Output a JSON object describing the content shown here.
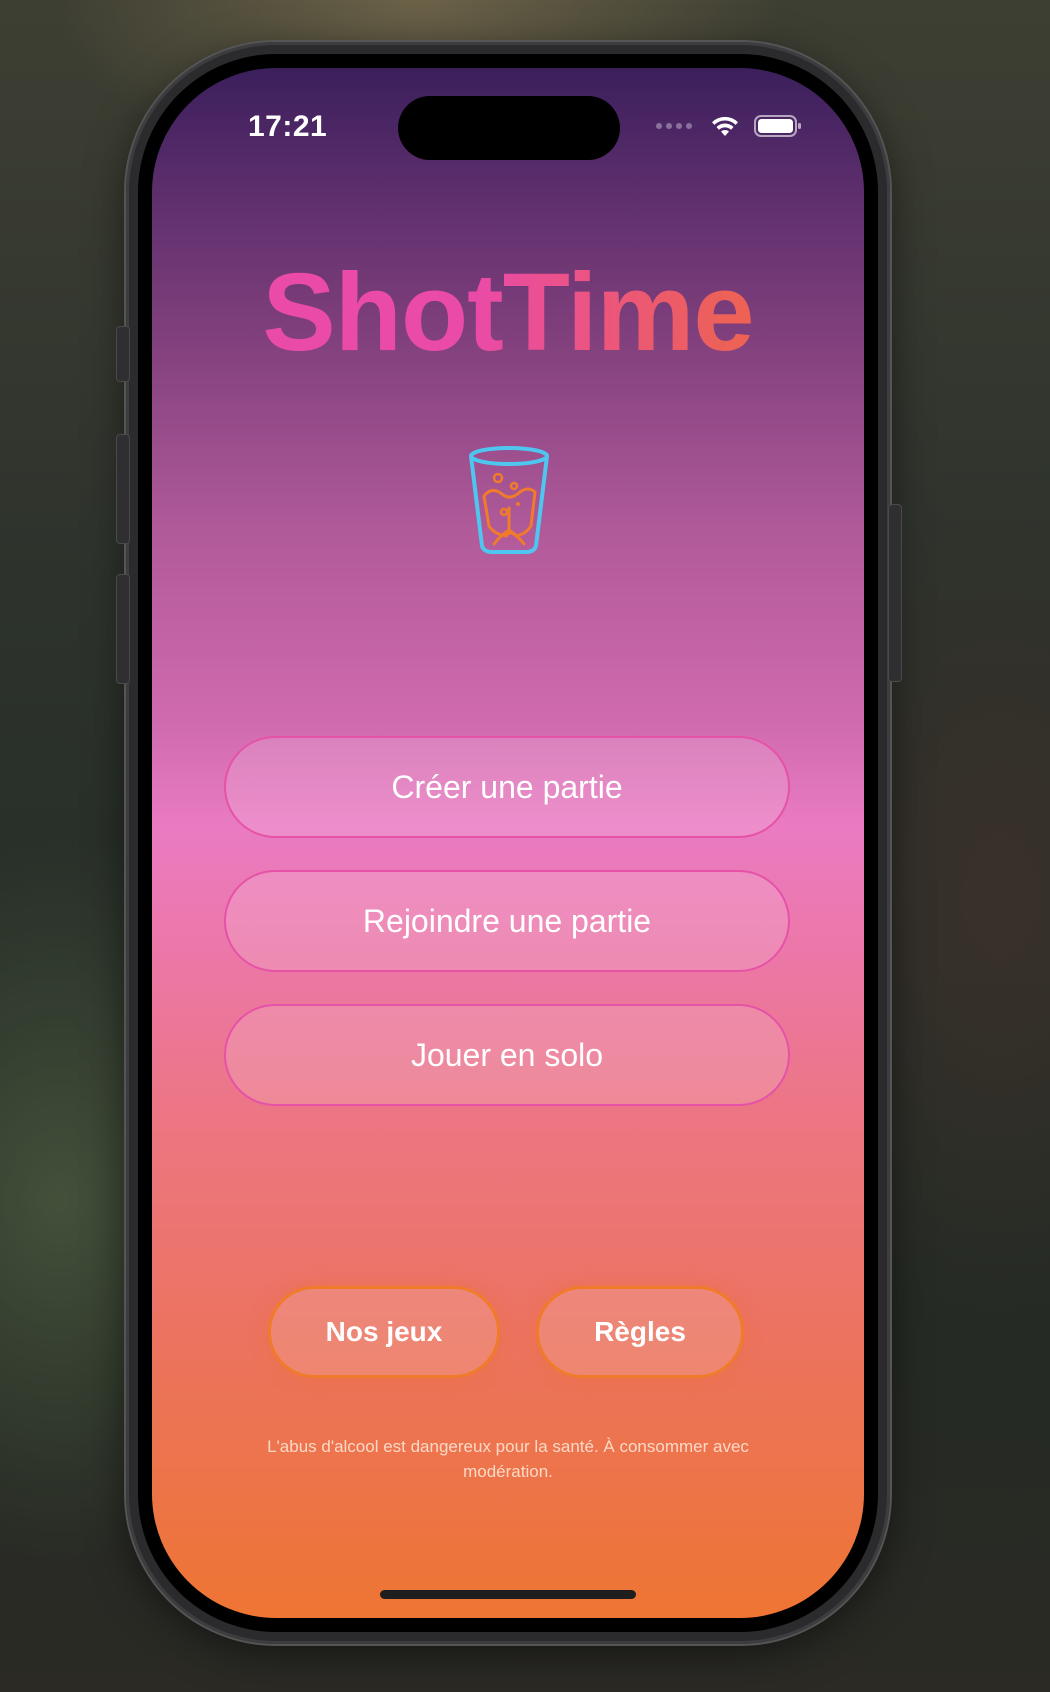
{
  "status_bar": {
    "time": "17:21",
    "wifi_icon": "wifi-icon",
    "battery_icon": "battery-icon"
  },
  "app": {
    "title": "ShotTime",
    "logo_icon": "shot-glass-icon"
  },
  "menu": {
    "create_label": "Créer une partie",
    "join_label": "Rejoindre une partie",
    "solo_label": "Jouer en solo"
  },
  "footer_buttons": {
    "games_label": "Nos jeux",
    "rules_label": "Règles"
  },
  "disclaimer": "L'abus d'alcool est dangereux pour la santé. À consommer avec modération.",
  "colors": {
    "title_pink": "#ea4aa8",
    "title_orange": "#ee6d32",
    "menu_border": "#e552a8",
    "pill_border": "#f07b2a",
    "glass_outline": "#4fc6f0",
    "glass_liquid": "#f07b2a"
  }
}
